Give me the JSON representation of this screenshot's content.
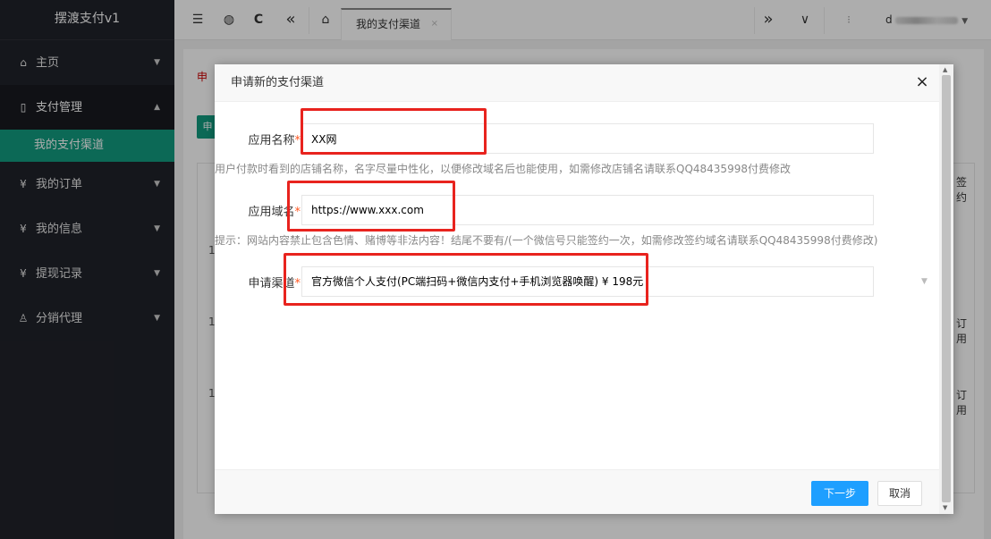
{
  "app": {
    "title": "摆渡支付v1"
  },
  "sidebar": {
    "items": [
      {
        "icon": "home-icon",
        "glyph": "⌂",
        "label": "主页",
        "arrow": "▼"
      },
      {
        "icon": "tablet-icon",
        "glyph": "▯",
        "label": "支付管理",
        "arrow": "▲"
      },
      {
        "label": "我的支付渠道"
      },
      {
        "icon": "yen-circle-icon",
        "glyph": "¥",
        "label": "我的订单",
        "arrow": "▼"
      },
      {
        "icon": "yen-circle-icon",
        "glyph": "¥",
        "label": "我的信息",
        "arrow": "▼"
      },
      {
        "icon": "yen-circle-icon",
        "glyph": "¥",
        "label": "提现记录",
        "arrow": "▼"
      },
      {
        "icon": "user-icon",
        "glyph": "♙",
        "label": "分销代理",
        "arrow": "▼"
      }
    ]
  },
  "topbar": {
    "icons": [
      "☰",
      "◍",
      "C",
      "«",
      "⌂"
    ],
    "tab_label": "我的支付渠道",
    "tab_close": "×",
    "right_icons": [
      "»",
      "∨",
      "⁝"
    ],
    "user_prefix": "d",
    "user_arrow": "▼"
  },
  "background": {
    "red_text": "申",
    "btn_text": "申",
    "col_fragment": "签约",
    "row_texts": [
      "1",
      "1",
      "1"
    ],
    "link_fragment": "订用"
  },
  "modal": {
    "title": "申请新的支付渠道",
    "close": "×",
    "fields": {
      "app_name": {
        "label": "应用名称",
        "required": "*",
        "value": "XX网"
      },
      "app_name_hint": "用户付款时看到的店铺名称，名字尽量中性化，以便修改域名后也能使用，如需修改店铺名请联系QQ48435998付费修改",
      "domain": {
        "label": "应用域名",
        "required": "*",
        "value": "https://www.xxx.com"
      },
      "domain_hint": "提示：网站内容禁止包含色情、赌博等非法内容！结尾不要有/(一个微信号只能签约一次，如需修改签约域名请联系QQ48435998付费修改)",
      "channel": {
        "label": "申请渠道",
        "required": "*",
        "value": "官方微信个人支付(PC端扫码+微信内支付+手机浏览器唤醒) ¥ 198元"
      }
    },
    "buttons": {
      "next": "下一步",
      "cancel": "取消"
    }
  },
  "colors": {
    "sidebar_bg": "#20222a",
    "accent_green": "#129b7f",
    "primary_blue": "#1e9fff",
    "highlight_red": "#e8231e"
  }
}
